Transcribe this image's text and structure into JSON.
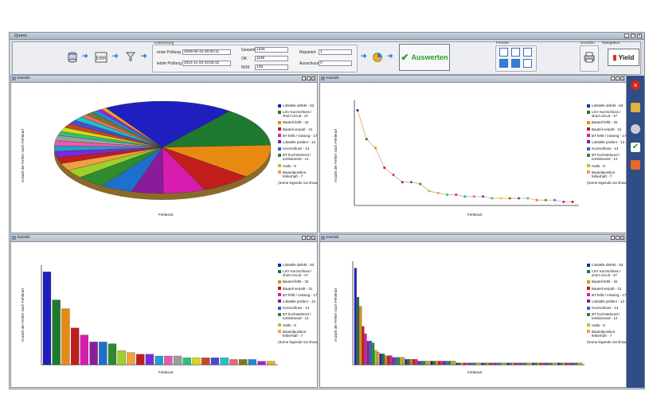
{
  "window": {
    "title": "Quess"
  },
  "toolbar": {
    "auswertung_group_label": "Auswertung",
    "erste_pruefung_label": "erste Prüfung",
    "erste_pruefung_value": "2009-06-22   00:00:11",
    "letzte_pruefung_label": "letzte Prüfung",
    "letzte_pruefung_value": "2014-11-03   23:58:42",
    "gesamt_label": "Gesamt",
    "gesamt_value": "1325",
    "ok_label": "OK",
    "ok_value": "1190",
    "nok_label": "NOK",
    "nok_value": "135",
    "repariert_label": "Repariert",
    "repariert_value": "1",
    "ausschuss_label": "Ausschuss",
    "ausschuss_value": "0",
    "auswerten_label": "Auswerten",
    "fenster_label": "Fenster",
    "drucken_label": "Drucken",
    "navigation_label": "Navigation",
    "yield_label": "Yield"
  },
  "panels": [
    {
      "title": "Statistik"
    },
    {
      "title": "Statistik"
    },
    {
      "title": "Statistik"
    },
    {
      "title": "Statistik"
    }
  ],
  "axes": {
    "ylabel": "Anzahl der Fehler nach Fehlerart",
    "xlabel": "Fehlerart"
  },
  "legend": {
    "items": [
      {
        "label": "Lötstelle defekt - 53",
        "color": "#1f1fbf"
      },
      {
        "label": "LSV Kurzschluss / short circuit - 37",
        "color": "#1e7a2e"
      },
      {
        "label": "Bauteil fehlt - 32",
        "color": "#e88a12"
      },
      {
        "label": "Bauteil verpolt - 21",
        "color": "#c21d1d"
      },
      {
        "label": "BT fehlt / missing - 17",
        "color": "#d91cb0"
      },
      {
        "label": "Lötstelle prüfen! - 13",
        "color": "#8a1c9b"
      },
      {
        "label": "Kurzschluss - 13",
        "color": "#1f6fcf"
      },
      {
        "label": "BT hochstehend / tombstoned - 12",
        "color": "#2e8b2e"
      },
      {
        "label": "Hallo - 8",
        "color": "#9fcf2a"
      },
      {
        "label": "Bauteilposition fehlerhaft - 7",
        "color": "#f0a040"
      }
    ],
    "more": "(Some legends not show"
  },
  "colors": {
    "accent": "#2f7fd6",
    "auswerten": "#2a9b2a",
    "sidebar": "#2f4e85"
  },
  "chart_data": [
    {
      "type": "pie",
      "categories": [
        "Lötstelle defekt",
        "LSV Kurzschluss / short circuit",
        "Bauteil fehlt",
        "Bauteil verpolt",
        "BT fehlt / missing",
        "Lötstelle prüfen!",
        "Kurzschluss",
        "BT hochstehend / tombstoned",
        "Hallo",
        "Bauteilposition fehlerhaft",
        "",
        "",
        "",
        "",
        "",
        "",
        "",
        "",
        "",
        "",
        "",
        "",
        "",
        "",
        ""
      ],
      "values": [
        53,
        37,
        32,
        21,
        17,
        13,
        13,
        12,
        8,
        7,
        6,
        6,
        5,
        5,
        5,
        4,
        4,
        4,
        4,
        4,
        3,
        3,
        3,
        2,
        2
      ],
      "colors": [
        "#1f1fbf",
        "#1e7a2e",
        "#e88a12",
        "#c21d1d",
        "#d91cb0",
        "#8a1c9b",
        "#1f6fcf",
        "#2e8b2e",
        "#9fcf2a",
        "#f0a040",
        "#c21d1d",
        "#7a2ad9",
        "#1fa0cf",
        "#e85ab0",
        "#9e9e9e",
        "#2ec27a",
        "#d9d91c",
        "#c24a1d",
        "#4a4ad9",
        "#1ec2c2",
        "#e86a6a",
        "#7a7a1c",
        "#1c8ad9",
        "#b01cd9",
        "#e8b01c"
      ],
      "xlabel": "Fehlerart",
      "ylabel": "Anzahl der Fehler nach Fehlerart"
    },
    {
      "type": "line",
      "x": [
        1,
        2,
        3,
        4,
        5,
        6,
        7,
        8,
        9,
        10,
        11,
        12,
        13,
        14,
        15,
        16,
        17,
        18,
        19,
        20,
        21,
        22,
        23,
        24,
        25
      ],
      "values": [
        53,
        37,
        32,
        21,
        17,
        13,
        13,
        12,
        8,
        7,
        6,
        6,
        5,
        5,
        5,
        4,
        4,
        4,
        4,
        4,
        3,
        3,
        3,
        2,
        2
      ],
      "point_colors": [
        "#1f1fbf",
        "#1e7a2e",
        "#e88a12",
        "#c21d1d",
        "#d91cb0",
        "#8a1c9b",
        "#1f6fcf",
        "#2e8b2e",
        "#9fcf2a",
        "#f0a040",
        "#2ec27a",
        "#d91cb0",
        "#1fa0cf",
        "#e85ab0",
        "#7a2ad9",
        "#2ec27a",
        "#d9d91c",
        "#c24a1d",
        "#4a4ad9",
        "#1ec2c2",
        "#e86a6a",
        "#7a7a1c",
        "#1c8ad9",
        "#b01cd9",
        "#c21d1d"
      ],
      "xlabel": "Fehlerart",
      "ylabel": "Anzahl der Fehler nach Fehlerart"
    },
    {
      "type": "bar",
      "values": [
        53,
        37,
        32,
        21,
        17,
        13,
        13,
        12,
        8,
        7,
        6,
        6,
        5,
        5,
        5,
        4,
        4,
        4,
        4,
        4,
        3,
        3,
        3,
        2,
        2
      ],
      "colors": [
        "#1f1fbf",
        "#1e7a2e",
        "#e88a12",
        "#c21d1d",
        "#d91cb0",
        "#8a1c9b",
        "#1f6fcf",
        "#2e8b2e",
        "#9fcf2a",
        "#f0a040",
        "#c21d1d",
        "#7a2ad9",
        "#1fa0cf",
        "#e85ab0",
        "#9e9e9e",
        "#2ec27a",
        "#d9d91c",
        "#c24a1d",
        "#4a4ad9",
        "#1ec2c2",
        "#e86a6a",
        "#7a7a1c",
        "#1c8ad9",
        "#b01cd9",
        "#e8b01c"
      ],
      "xlabel": "Fehlerart",
      "ylabel": "Anzahl der Fehler nach Fehlerart"
    },
    {
      "type": "bar",
      "values": [
        53,
        37,
        32,
        21,
        17,
        13,
        13,
        12,
        8,
        7,
        6,
        6,
        5,
        5,
        5,
        4,
        4,
        4,
        4,
        4,
        3,
        3,
        3,
        3,
        3,
        2,
        2,
        2,
        2,
        2,
        2,
        2,
        2,
        2,
        2,
        2,
        2,
        2,
        2,
        2,
        1,
        1,
        1,
        1,
        1,
        1,
        1,
        1,
        1,
        1,
        1,
        1,
        1,
        1,
        1,
        1,
        1,
        1,
        1,
        1,
        1,
        1,
        1,
        1,
        1,
        1,
        1,
        1,
        1,
        1,
        1,
        1,
        1,
        1,
        1,
        1,
        1,
        1,
        1,
        1,
        1,
        1,
        1,
        1,
        1,
        1,
        1,
        1,
        1,
        1
      ],
      "xlabel": "Fehlerart",
      "ylabel": "Anzahl der Fehler nach Fehlerart"
    }
  ]
}
